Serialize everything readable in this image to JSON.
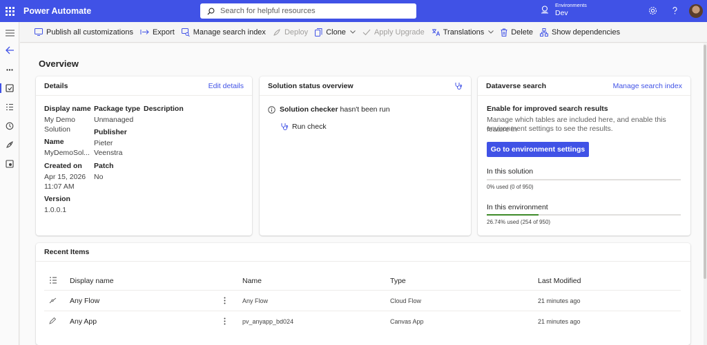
{
  "header": {
    "app_title": "Power Automate",
    "search_placeholder": "Search for helpful resources",
    "environment_label": "Environments",
    "environment_name": "Dev"
  },
  "commands": [
    {
      "label": "Publish all customizations",
      "icon": "publish-icon",
      "disabled": false
    },
    {
      "label": "Export",
      "icon": "export-icon",
      "disabled": false
    },
    {
      "label": "Manage search index",
      "icon": "search-index-icon",
      "disabled": false
    },
    {
      "label": "Deploy",
      "icon": "rocket-icon",
      "disabled": true
    },
    {
      "label": "Clone",
      "icon": "clone-icon",
      "disabled": false,
      "dropdown": true
    },
    {
      "label": "Apply Upgrade",
      "icon": "checkmark-icon",
      "disabled": true
    },
    {
      "label": "Translations",
      "icon": "translate-icon",
      "disabled": false,
      "dropdown": true
    },
    {
      "label": "Delete",
      "icon": "trash-icon",
      "disabled": false
    },
    {
      "label": "Show dependencies",
      "icon": "dependencies-icon",
      "disabled": false
    }
  ],
  "page": {
    "title": "Overview"
  },
  "details": {
    "title": "Details",
    "edit_link": "Edit details",
    "display_name_label": "Display name",
    "display_name_value_1": "My Demo",
    "display_name_value_2": "Solution",
    "name_label": "Name",
    "name_value": "MyDemoSol...",
    "created_on_label": "Created on",
    "created_on_date": "Apr 15, 2026",
    "created_on_time": "11:07 AM",
    "version_label": "Version",
    "version_value": "1.0.0.1",
    "package_type_label": "Package type",
    "package_type_value": "Unmanaged",
    "publisher_label": "Publisher",
    "publisher_value_1": "Pieter",
    "publisher_value_2": "Veenstra",
    "patch_label": "Patch",
    "patch_value": "No",
    "description_label": "Description"
  },
  "solution_status": {
    "title": "Solution status overview",
    "checker_bold": "Solution checker",
    "checker_rest": "hasn't been run",
    "run_check": "Run check"
  },
  "dataverse": {
    "title": "Dataverse search",
    "manage_link": "Manage search index",
    "enable_title": "Enable for improved search results",
    "description_1": "Manage which tables are included here, and enable this feature in",
    "description_2": "environment settings to see the results.",
    "button": "Go to environment settings",
    "in_solution_label": "In this solution",
    "in_solution_usage": "0% used (0 of 950)",
    "in_solution_fraction": 0,
    "in_environment_label": "In this environment",
    "in_environment_usage": "26.74% used (254 of 950)",
    "in_environment_fraction": 0.2674,
    "progress_color": "#3d8a28"
  },
  "recent": {
    "title": "Recent Items",
    "columns": {
      "display_name": "Display name",
      "name": "Name",
      "type": "Type",
      "last_modified": "Last Modified"
    },
    "rows": [
      {
        "icon": "flow-icon",
        "display_name": "Any Flow",
        "name": "Any Flow",
        "type": "Cloud Flow",
        "last_modified": "21 minutes ago"
      },
      {
        "icon": "pencil-icon",
        "display_name": "Any App",
        "name": "pv_anyapp_bd024",
        "type": "Canvas App",
        "last_modified": "21 minutes ago"
      }
    ]
  },
  "colors": {
    "brand": "#4052e6",
    "link": "#4052e6",
    "progress": "#3d8a28"
  }
}
